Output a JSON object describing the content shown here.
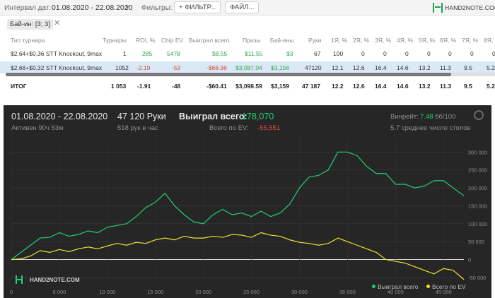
{
  "toolbar": {
    "interval_label": "Интервал дат:",
    "date_range": "01.08.2020 - 22.08.2020",
    "filters_label": "Фильтры:",
    "filter_button": "ФИЛЬТР...",
    "files_button": "ФАЙЛ...",
    "logo_text": "HAND2NOTE.COM"
  },
  "buyin_chip": {
    "label": "Бай-ин: [3; 3]",
    "close": "✕"
  },
  "table": {
    "headers": [
      "Тип турнира",
      "Турниры",
      "ROI, %",
      "Chip EV",
      "Выиграл всего",
      "Призы",
      "Бай-ины",
      "Руки",
      "1Я, %",
      "2Я, %",
      "3Я, %",
      "4Я, %",
      "5Я, %",
      "6Я, %",
      "7Я, %",
      "8Я, %"
    ],
    "rows": [
      [
        "$2,64+$0,36 STT Knockout, 9max",
        "1",
        "285",
        "5478",
        "$8.55",
        "$11.55",
        "$3",
        "67",
        "100",
        "0",
        "0",
        "0",
        "0",
        "0",
        "0",
        "0"
      ],
      [
        "$2,68+$0,32 STT Knockout, 9max",
        "1052",
        "-2.19",
        "-53",
        "-$68.96",
        "$3,087.04",
        "$3,156",
        "47120",
        "12.1",
        "12.6",
        "16.4",
        "14.6",
        "13.2",
        "11.3",
        "9.5",
        "5.2"
      ]
    ],
    "total": [
      "ИТОГ",
      "1 053",
      "-1.91",
      "-48",
      "-$60.41",
      "$3,098.59",
      "$3,159",
      "47 187",
      "12.2",
      "12.6",
      "16.4",
      "14.6",
      "13.2",
      "11.3",
      "9.5",
      "5.2"
    ]
  },
  "panel": {
    "date_range": "01.08.2020 - 22.08.2020",
    "active": "Активен 90ч 53м",
    "hands": "47 120 Руки",
    "hands_per_hour": "518 рук в час",
    "won_label": "Выиграл всего:",
    "won_value": "178,070",
    "ev_label": "Всего по EV:",
    "ev_value": "-55,551",
    "winrate_label": "Винрейт:",
    "winrate_value": "7.48",
    "winrate_suffix": "бб/100",
    "avg_tables": "5.7 среднее число столов",
    "watermark": "HAND2NOTE.COM"
  },
  "colors": {
    "green": "#1fd07a",
    "yellow": "#e8e530",
    "red": "#e24b4b",
    "panel_bg": "#262626"
  },
  "chart_data": {
    "type": "line",
    "xlabel": "",
    "ylabel": "",
    "xlim": [
      0,
      47120
    ],
    "ylim": [
      -60000,
      340000
    ],
    "x_ticks": [
      "0",
      "5 000",
      "10 000",
      "15 000",
      "20 000",
      "25 000",
      "30 000",
      "35 000",
      "40 000",
      "45 000"
    ],
    "y_ticks": [
      "300 000",
      "250 000",
      "200 000",
      "150 000",
      "100 000",
      "50 000",
      "0",
      "-50 000"
    ],
    "legend_position": "bottom-right",
    "grid": true,
    "x": [
      0,
      1000,
      2000,
      3000,
      4000,
      5000,
      6000,
      7000,
      8000,
      9000,
      10000,
      11000,
      12000,
      13000,
      14000,
      15000,
      16000,
      17000,
      18000,
      19000,
      20000,
      21000,
      22000,
      23000,
      24000,
      25000,
      26000,
      27000,
      28000,
      29000,
      30000,
      31000,
      32000,
      33000,
      34000,
      35000,
      36000,
      37000,
      38000,
      39000,
      40000,
      41000,
      42000,
      43000,
      44000,
      45000,
      46000,
      47120
    ],
    "series": [
      {
        "name": "Выиграл всего",
        "color": "#1fd07a",
        "values": [
          0,
          20000,
          40000,
          60000,
          62000,
          75000,
          65000,
          70000,
          80000,
          75000,
          90000,
          95000,
          100000,
          120000,
          145000,
          160000,
          185000,
          150000,
          125000,
          105000,
          100000,
          125000,
          140000,
          125000,
          130000,
          120000,
          135000,
          120000,
          130000,
          155000,
          200000,
          230000,
          235000,
          250000,
          300000,
          300000,
          290000,
          260000,
          240000,
          240000,
          210000,
          210000,
          200000,
          205000,
          220000,
          220000,
          200000,
          178070
        ]
      },
      {
        "name": "Всего по EV",
        "color": "#e8e530",
        "values": [
          0,
          2000,
          10000,
          25000,
          20000,
          28000,
          22000,
          30000,
          35000,
          30000,
          38000,
          45000,
          40000,
          48000,
          45000,
          55000,
          60000,
          55000,
          65000,
          60000,
          60000,
          65000,
          62000,
          70000,
          68000,
          62000,
          75000,
          68000,
          65000,
          55000,
          48000,
          45000,
          40000,
          45000,
          60000,
          50000,
          40000,
          30000,
          20000,
          0,
          -5000,
          -10000,
          -20000,
          -30000,
          -40000,
          -25000,
          -30000,
          -55551
        ]
      }
    ]
  }
}
